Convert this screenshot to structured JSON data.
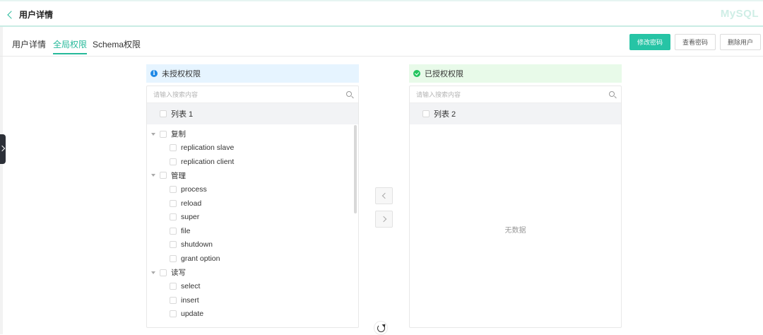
{
  "header": {
    "title": "用户详情",
    "brand": "MySQL"
  },
  "tabs": [
    {
      "label": "用户详情",
      "active": false
    },
    {
      "label": "全局权限",
      "active": true
    },
    {
      "label": "Schema权限",
      "active": false
    }
  ],
  "actions": {
    "change_password": "修改密码",
    "view_password": "查看密码",
    "delete_user": "删除用户"
  },
  "left_panel": {
    "title": "未授权权限",
    "search_placeholder": "请输入搜索内容",
    "list_label": "列表 1",
    "tree": [
      {
        "label": "复制",
        "children": [
          "replication slave",
          "replication client"
        ]
      },
      {
        "label": "管理",
        "children": [
          "process",
          "reload",
          "super",
          "file",
          "shutdown",
          "grant option"
        ]
      },
      {
        "label": "读写",
        "children": [
          "select",
          "insert",
          "update"
        ]
      }
    ]
  },
  "right_panel": {
    "title": "已授权权限",
    "search_placeholder": "请输入搜索内容",
    "list_label": "列表 2",
    "empty_text": "无数据"
  },
  "colors": {
    "accent": "#26b99a",
    "primary_button": "#26c4a5",
    "info": "#1e88e5",
    "success": "#22c55e"
  }
}
